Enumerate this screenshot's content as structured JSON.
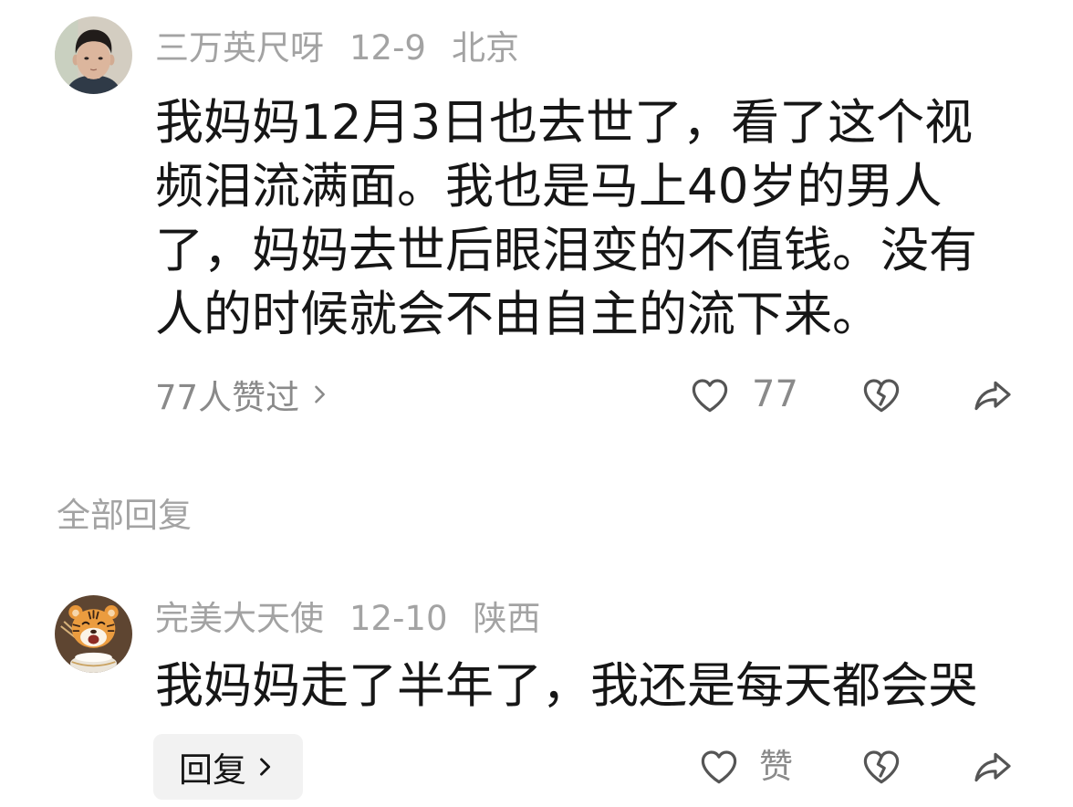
{
  "colors": {
    "background": "#ffffff",
    "text_primary": "#161616",
    "text_secondary": "#a3a3a3",
    "text_muted": "#8a8a8a",
    "icon": "#555555",
    "reply_button_bg": "#f2f2f2"
  },
  "icons": {
    "like": "heart-outline-icon",
    "dislike": "broken-heart-icon",
    "share": "share-icon",
    "more": "chevron-right-icon"
  },
  "main_comment": {
    "avatar": "man-photo-avatar",
    "author": "三万英尺呀",
    "date": "12-9",
    "location": "北京",
    "body_lines": [
      "我妈妈12月3日也去世了，看了这个视",
      "频泪流满面。我也是马上40岁的男人",
      "了，妈妈去世后眼泪变的不值钱。没有",
      "人的时候就会不由自主的流下来。"
    ],
    "likes_summary": "77人赞过",
    "like_count": "77"
  },
  "replies_header": "全部回复",
  "replies": [
    {
      "avatar": "tiger-cartoon-avatar",
      "author": "完美大天使",
      "date": "12-10",
      "location": "陕西",
      "body_lines": [
        "我妈妈走了半年了，我还是每天都会哭"
      ],
      "reply_label": "回复",
      "like_label": "赞"
    }
  ]
}
